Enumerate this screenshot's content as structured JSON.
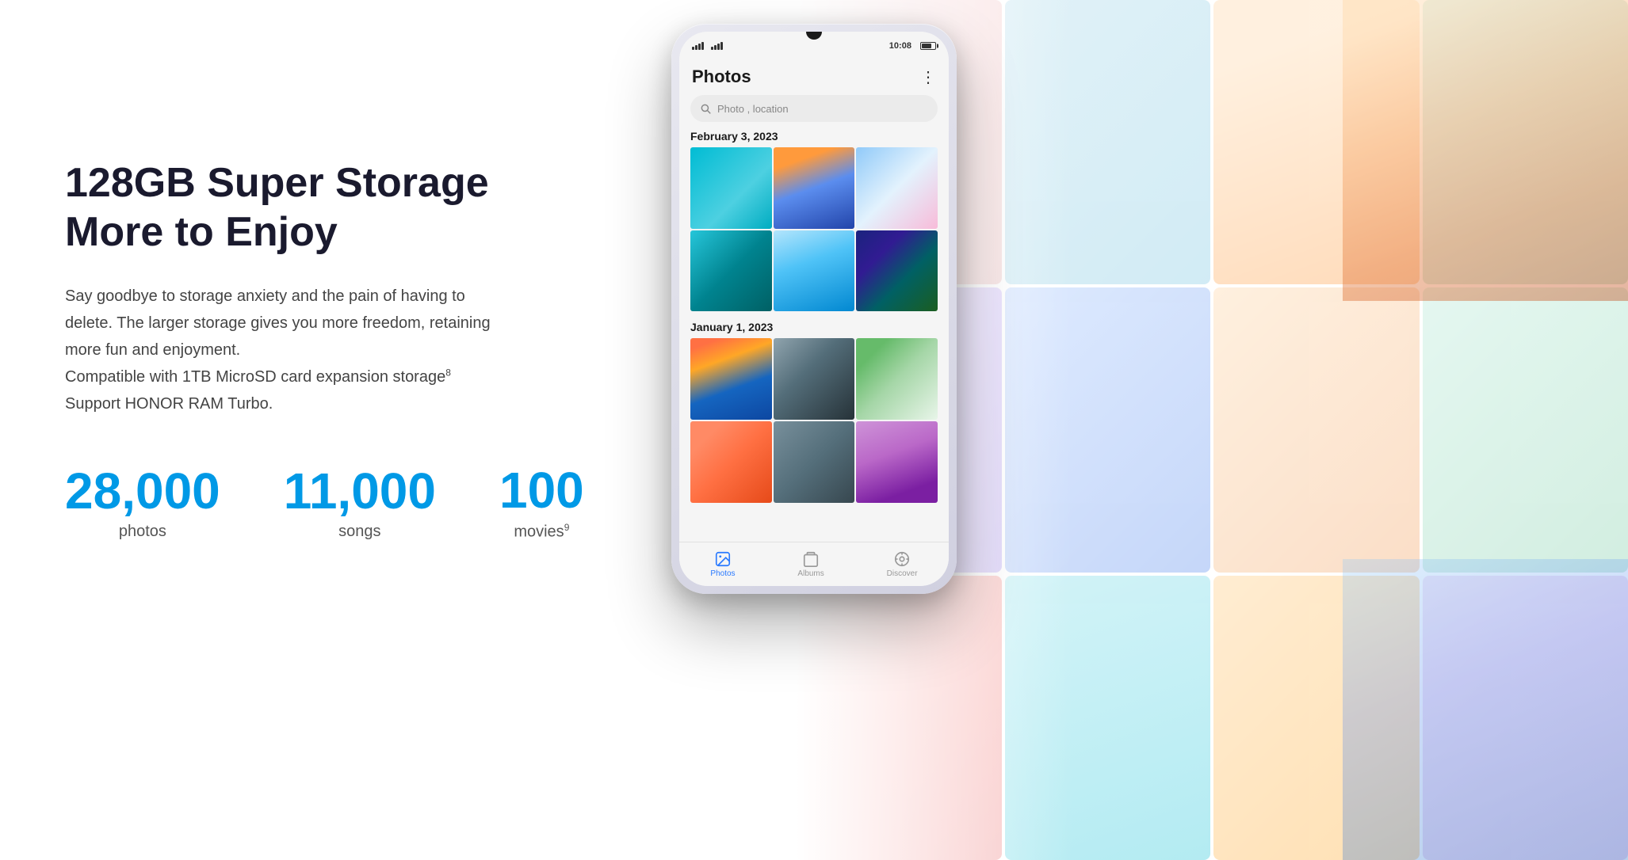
{
  "page": {
    "background_color": "#ffffff"
  },
  "left_content": {
    "title_line1": "128GB Super Storage",
    "title_line2": "More to Enjoy",
    "description_line1": "Say goodbye to storage anxiety and the pain of having to",
    "description_line2": "delete. The larger storage gives you more freedom, retaining",
    "description_line3": "more fun and enjoyment.",
    "feature1": "Compatible with 1TB MicroSD card expansion storage",
    "feature1_sup": "8",
    "feature2": "Support HONOR RAM Turbo.",
    "stats": [
      {
        "number": "28,000",
        "label": "photos",
        "sup": ""
      },
      {
        "number": "11,000",
        "label": "songs",
        "sup": ""
      },
      {
        "number": "100",
        "label": "movies",
        "sup": "9"
      }
    ]
  },
  "phone": {
    "status_bar": {
      "signal_left": "▪▪▪▪",
      "time": "10:08"
    },
    "app": {
      "title": "Photos",
      "more_icon": "⋮",
      "search_placeholder": "Photo , location",
      "sections": [
        {
          "date": "February 3, 2023",
          "photos": [
            {
              "id": "teal",
              "class": "photo-teal"
            },
            {
              "id": "harbor",
              "class": "photo-harbor"
            },
            {
              "id": "child",
              "class": "photo-child"
            },
            {
              "id": "ocean",
              "class": "photo-ocean"
            },
            {
              "id": "pool",
              "class": "photo-pool"
            },
            {
              "id": "aurora",
              "class": "photo-aurora"
            }
          ]
        },
        {
          "date": "January 1, 2023",
          "photos": [
            {
              "id": "venice",
              "class": "photo-venice"
            },
            {
              "id": "bridge",
              "class": "photo-bridge"
            },
            {
              "id": "couple",
              "class": "photo-couple"
            },
            {
              "id": "selfie1",
              "class": "photo-selfie1"
            },
            {
              "id": "selfie2",
              "class": "photo-selfie2"
            },
            {
              "id": "selfie3",
              "class": "photo-selfie3"
            }
          ]
        }
      ],
      "bottom_nav": [
        {
          "label": "Photos",
          "active": true,
          "icon": "photos"
        },
        {
          "label": "Albums",
          "active": false,
          "icon": "albums"
        },
        {
          "label": "Discover",
          "active": false,
          "icon": "discover"
        }
      ]
    }
  },
  "colors": {
    "accent_blue": "#0099e6",
    "nav_active": "#2979ff",
    "text_dark": "#1a1a2e",
    "text_body": "#444444"
  }
}
